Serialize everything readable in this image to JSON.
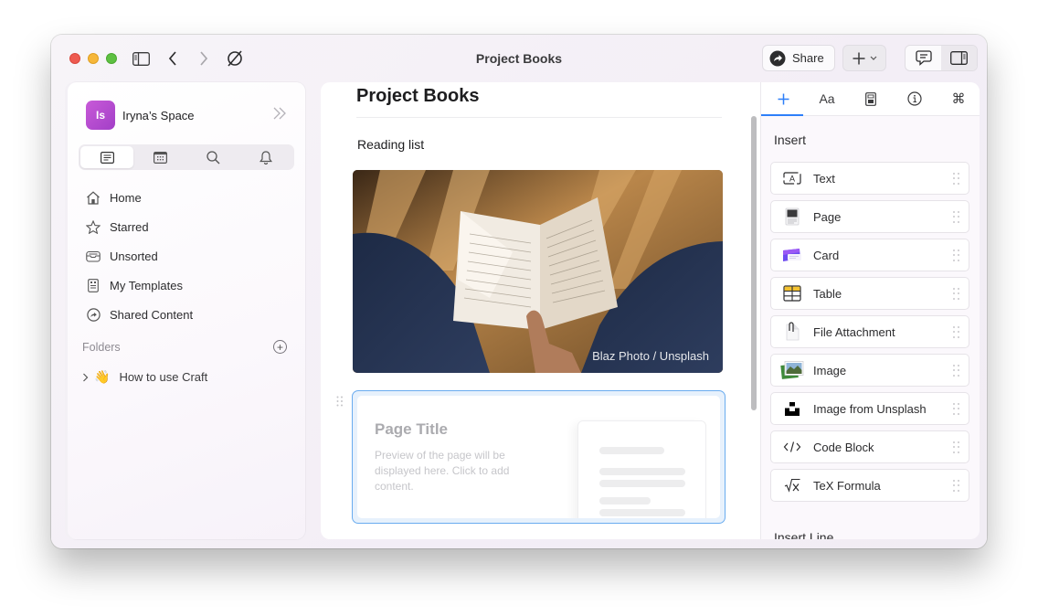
{
  "window": {
    "title": "Project Books",
    "share_label": "Share"
  },
  "sidebar": {
    "space_initials": "Is",
    "space_name": "Iryna’s Space",
    "tabs": [
      {
        "name": "documents",
        "icon": "document-icon",
        "active": true
      },
      {
        "name": "calendar",
        "icon": "calendar-icon",
        "active": false
      },
      {
        "name": "search",
        "icon": "search-icon",
        "active": false
      },
      {
        "name": "notifications",
        "icon": "bell-icon",
        "active": false
      }
    ],
    "nav": [
      {
        "label": "Home",
        "icon": "home-icon"
      },
      {
        "label": "Starred",
        "icon": "star-icon"
      },
      {
        "label": "Unsorted",
        "icon": "tray-icon"
      },
      {
        "label": "My Templates",
        "icon": "template-icon"
      },
      {
        "label": "Shared Content",
        "icon": "shared-icon"
      }
    ],
    "folders_label": "Folders",
    "folders": [
      {
        "emoji": "👋",
        "label": "How to use Craft"
      }
    ]
  },
  "document": {
    "title": "Project Books",
    "text": "Reading list",
    "image_credit": "Blaz Photo / Unsplash",
    "page_card": {
      "title": "Page Title",
      "description": "Preview of the page will be displayed here. Click to add content."
    }
  },
  "panel": {
    "tabs": [
      {
        "name": "insert",
        "glyph": "+",
        "active": true
      },
      {
        "name": "style",
        "glyph": "Aa",
        "active": false
      },
      {
        "name": "page-format",
        "glyph": "",
        "active": false
      },
      {
        "name": "info",
        "glyph": "",
        "active": false
      },
      {
        "name": "shortcuts",
        "glyph": "⌘",
        "active": false
      }
    ],
    "insert_header": "Insert",
    "items": [
      {
        "label": "Text",
        "icon": "text-block-icon"
      },
      {
        "label": "Page",
        "icon": "page-icon"
      },
      {
        "label": "Card",
        "icon": "card-icon"
      },
      {
        "label": "Table",
        "icon": "table-icon"
      },
      {
        "label": "File Attachment",
        "icon": "file-attachment-icon"
      },
      {
        "label": "Image",
        "icon": "image-icon"
      },
      {
        "label": "Image from Unsplash",
        "icon": "unsplash-icon"
      },
      {
        "label": "Code Block",
        "icon": "code-icon"
      },
      {
        "label": "TeX Formula",
        "icon": "formula-icon"
      }
    ],
    "insert_line_header": "Insert Line"
  }
}
